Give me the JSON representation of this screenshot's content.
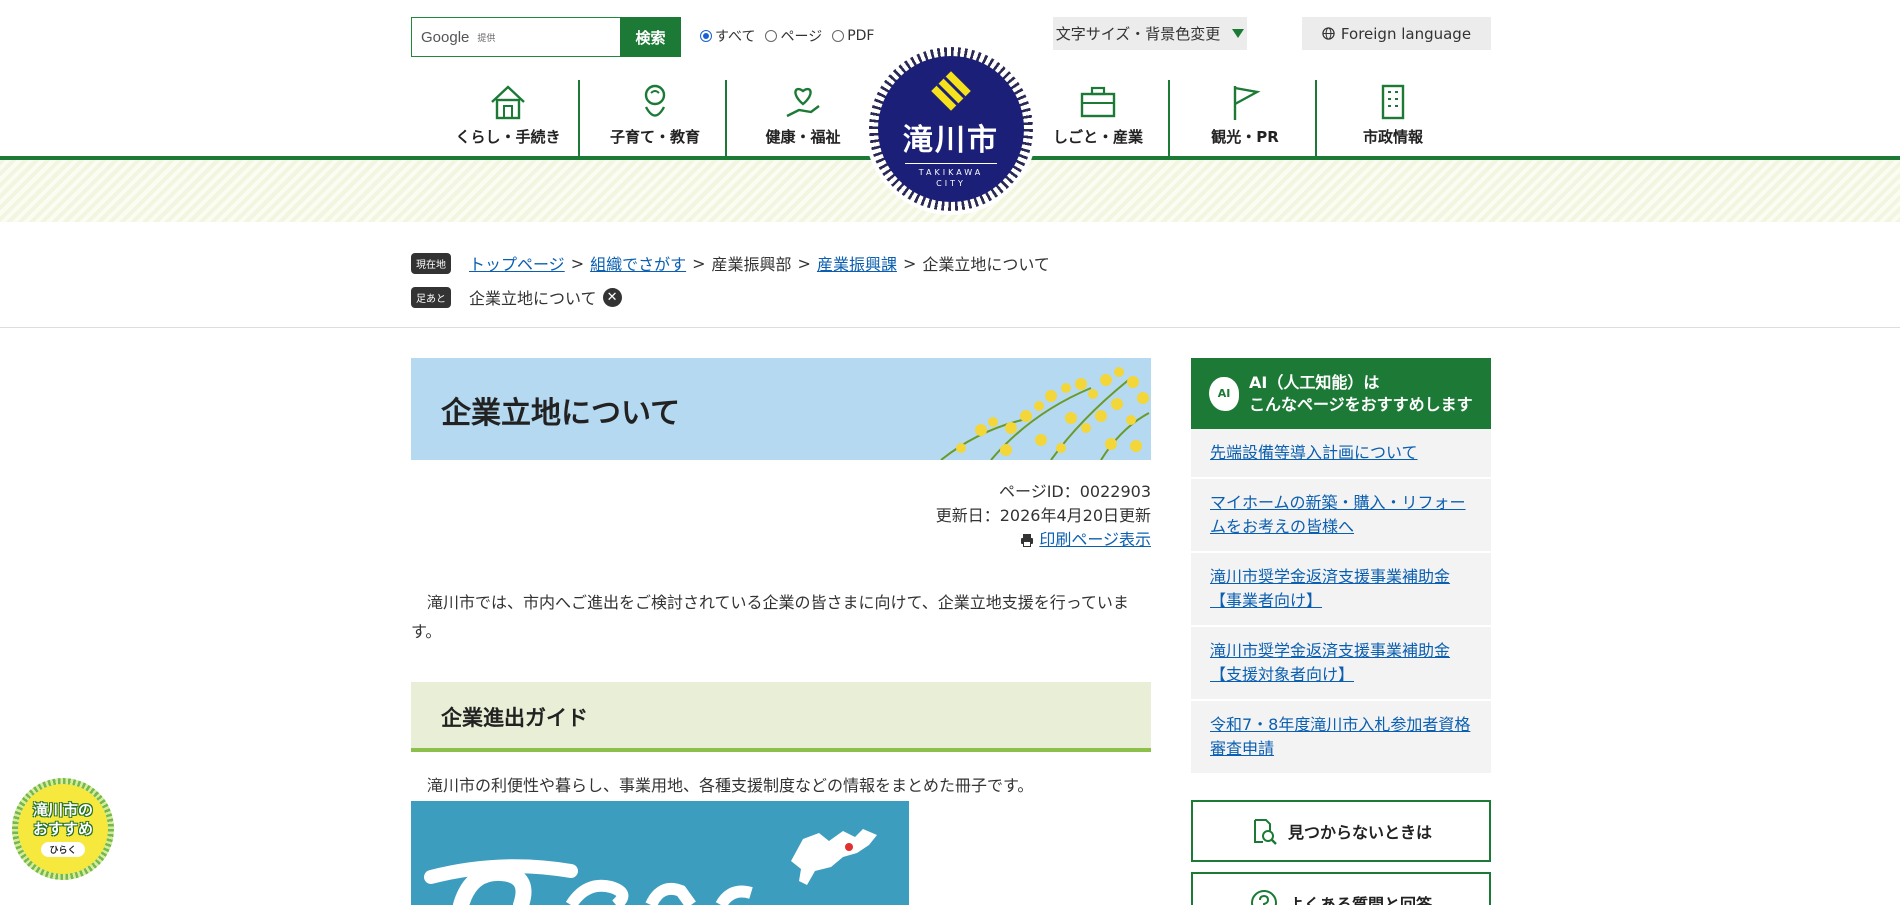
{
  "header": {
    "search": {
      "engine_word": "Google",
      "engine_sub": "提供",
      "button_label": "検索"
    },
    "search_scope": [
      {
        "label": "すべて",
        "selected": true
      },
      {
        "label": "ページ",
        "selected": false
      },
      {
        "label": "PDF",
        "selected": false
      }
    ],
    "font_size_label": "文字サイズ・背景色変更",
    "language_label": "Foreign language",
    "logo": {
      "name": "滝川市",
      "english_1": "TAKIKAWA",
      "english_2": "CITY"
    }
  },
  "nav": [
    {
      "label": "くらし・手続き",
      "icon": "house-icon"
    },
    {
      "label": "子育て・教育",
      "icon": "baby-icon"
    },
    {
      "label": "健康・福祉",
      "icon": "heart-hand-icon"
    },
    {
      "label": "しごと・産業",
      "icon": "briefcase-icon"
    },
    {
      "label": "観光・PR",
      "icon": "flag-icon"
    },
    {
      "label": "市政情報",
      "icon": "building-icon"
    }
  ],
  "breadcrumb": {
    "current_tag": "現在地",
    "items": [
      "トップページ",
      "組織でさがす",
      "産業振興部",
      "産業振興課",
      "企業立地について"
    ],
    "footprint_tag": "足あと",
    "footprint_item": "企業立地について"
  },
  "page": {
    "title": "企業立地について",
    "page_id": "ページID：0022903",
    "updated": "更新日：2026年4月20日更新",
    "print_label": "印刷ページ表示",
    "intro": "滝川市では、市内へご進出をご検討されている企業の皆さまに向けて、企業立地支援を行っています。",
    "section_heading": "企業進出ガイド",
    "section_text": "滝川市の利便性や暮らし、事業用地、各種支援制度などの情報をまとめた冊子です。"
  },
  "sidebar": {
    "ai_badge": "AI",
    "ai_heading_1": "AI（人工知能）は",
    "ai_heading_2": "こんなページをおすすめします",
    "ai_links": [
      "先端設備等導入計画について",
      "マイホームの新築・購入・リフォームをお考えの皆様へ",
      "滝川市奨学金返済支援事業補助金【事業者向け】",
      "滝川市奨学金返済支援事業補助金【支援対象者向け】",
      "令和7・8年度滝川市入札参加者資格審査申請"
    ],
    "not_found_label": "見つからないときは",
    "faq_label": "よくある質問と回答"
  },
  "floating": {
    "line1": "滝川市の",
    "line2": "おすすめ",
    "button": "ひらく"
  },
  "colors": {
    "brand_green": "#1c7a36",
    "logo_navy": "#1b1f78",
    "banner_blue": "#b5d9f1",
    "section_band": "#e9efd6"
  }
}
